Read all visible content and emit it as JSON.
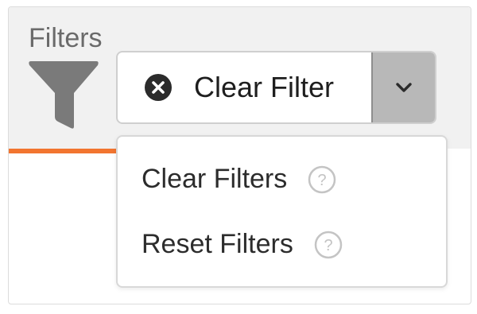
{
  "filters": {
    "section_label": "Filters",
    "section_icon": "funnel-icon",
    "accent_color": "#f27530"
  },
  "split_button": {
    "label": "Clear Filter",
    "icon": "close-circle-icon",
    "toggle_icon": "chevron-down-icon"
  },
  "dropdown_menu": {
    "items": [
      {
        "label": "Clear Filters",
        "icon": "help-icon"
      },
      {
        "label": "Reset Filters",
        "icon": "help-icon"
      }
    ]
  }
}
